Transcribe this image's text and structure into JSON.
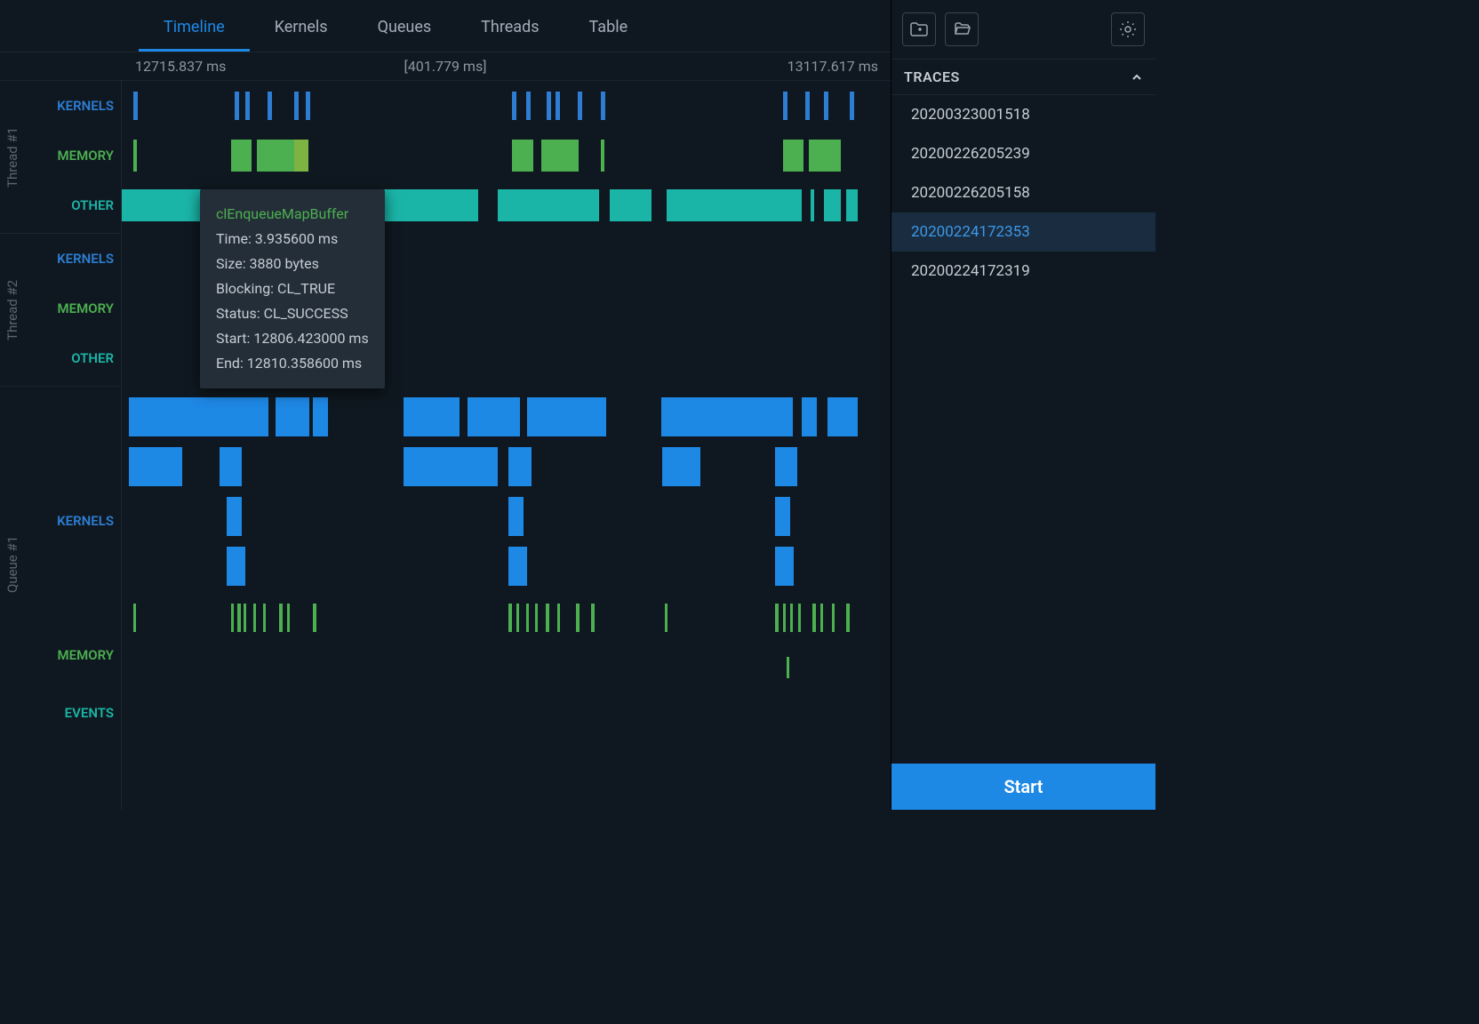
{
  "tabs": [
    "Timeline",
    "Kernels",
    "Queues",
    "Threads",
    "Table"
  ],
  "active_tab": 0,
  "timebar": {
    "start": "12715.837 ms",
    "span": "[401.779 ms]",
    "end": "13117.617 ms"
  },
  "groups": [
    {
      "name": "Thread #1",
      "rows": [
        {
          "label": "KERNELS",
          "color": "c-blue"
        },
        {
          "label": "MEMORY",
          "color": "c-green"
        },
        {
          "label": "OTHER",
          "color": "c-teal"
        }
      ]
    },
    {
      "name": "Thread #2",
      "rows": [
        {
          "label": "KERNELS",
          "color": "c-blue"
        },
        {
          "label": "MEMORY",
          "color": "c-green"
        },
        {
          "label": "OTHER",
          "color": "c-teal"
        }
      ]
    },
    {
      "name": "Queue #1",
      "rows": [
        {
          "label": "KERNELS",
          "color": "c-blue"
        },
        {
          "label": "MEMORY",
          "color": "c-green"
        },
        {
          "label": "EVENTS",
          "color": "c-teal"
        }
      ]
    }
  ],
  "tooltip": {
    "title": "clEnqueueMapBuffer",
    "time": "Time: 3.935600 ms",
    "size": "Size: 3880 bytes",
    "blocking": "Blocking: CL_TRUE",
    "status": "Status: CL_SUCCESS",
    "start": "Start: 12806.423000 ms",
    "end": "End: 12810.358600 ms"
  },
  "traces_header": "TRACES",
  "traces": [
    "20200323001518",
    "20200226205239",
    "20200226205158",
    "20200224172353",
    "20200224172319"
  ],
  "traces_selected": 3,
  "start_label": "Start",
  "chart_data": {
    "type": "bar",
    "x_range_ms": [
      12715.837,
      13117.617
    ],
    "span_ms": 401.779,
    "colors": {
      "KERNELS": "#2d7dd2",
      "MEMORY": "#4caf50",
      "OTHER": "#1bb5a8",
      "EVENTS": "#1bb5a8"
    },
    "lanes": {
      "thread1_kernels": [
        [
          1.5,
          0.6
        ],
        [
          15.0,
          0.6
        ],
        [
          16.5,
          0.6
        ],
        [
          19.4,
          0.6
        ],
        [
          22.9,
          0.6
        ],
        [
          24.5,
          0.6
        ],
        [
          52.0,
          0.6
        ],
        [
          53.8,
          0.6
        ],
        [
          56.6,
          0.6
        ],
        [
          57.7,
          0.6
        ],
        [
          60.7,
          0.6
        ],
        [
          63.8,
          0.6
        ],
        [
          88.0,
          0.6
        ],
        [
          91.0,
          0.6
        ],
        [
          93.5,
          0.6
        ],
        [
          96.9,
          0.6
        ]
      ],
      "thread1_memory": [
        [
          1.5,
          0.5
        ],
        [
          14.5,
          2.8
        ],
        [
          18.0,
          5.0
        ],
        [
          52.0,
          2.8
        ],
        [
          55.8,
          5.0
        ],
        [
          63.8,
          0.5
        ],
        [
          88.0,
          2.8
        ],
        [
          91.5,
          4.2
        ]
      ],
      "thread1_other": [
        [
          0,
          10.5
        ],
        [
          24.0,
          23.5
        ],
        [
          50.0,
          13.5
        ],
        [
          65.0,
          5.5
        ],
        [
          72.5,
          18.0
        ],
        [
          91.7,
          0.5
        ],
        [
          93.5,
          2.3
        ],
        [
          96.5,
          1.5
        ]
      ],
      "thread2_kernels": [],
      "thread2_memory": [],
      "thread2_other": [],
      "queue1_kernels_rows": [
        [
          [
            1,
            18.5
          ],
          [
            20.5,
            4.5
          ],
          [
            25.5,
            2.0
          ],
          [
            37.5,
            7.5
          ],
          [
            46,
            7.0
          ],
          [
            54,
            10.5
          ],
          [
            71.8,
            17.5
          ],
          [
            90.5,
            2.0
          ],
          [
            94,
            4.0
          ]
        ],
        [
          [
            1,
            7.0
          ],
          [
            13.0,
            3.0
          ],
          [
            37.5,
            12.5
          ],
          [
            51.5,
            3.0
          ],
          [
            72,
            5.0
          ],
          [
            87,
            3.0
          ]
        ],
        [
          [
            14,
            2.0
          ],
          [
            51.5,
            2.0
          ],
          [
            87,
            2.0
          ]
        ],
        [
          [
            14,
            2.5
          ],
          [
            51.5,
            2.5
          ],
          [
            87,
            2.5
          ]
        ]
      ],
      "queue1_memory": [
        [
          1.5,
          0.4
        ],
        [
          14.5,
          0.4
        ],
        [
          15.4,
          0.4
        ],
        [
          16.2,
          0.4
        ],
        [
          17.5,
          0.4
        ],
        [
          18.8,
          0.4
        ],
        [
          21,
          0.4
        ],
        [
          22,
          0.4
        ],
        [
          25.5,
          0.4
        ],
        [
          51.5,
          0.4
        ],
        [
          52.5,
          0.4
        ],
        [
          53.8,
          0.4
        ],
        [
          55,
          0.4
        ],
        [
          56.5,
          0.4
        ],
        [
          58,
          0.4
        ],
        [
          60.5,
          0.4
        ],
        [
          62.5,
          0.4
        ],
        [
          72.3,
          0.4
        ],
        [
          87,
          0.4
        ],
        [
          88,
          0.4
        ],
        [
          89,
          0.4
        ],
        [
          90,
          0.4
        ],
        [
          92,
          0.4
        ],
        [
          93,
          0.4
        ],
        [
          94.5,
          0.4
        ],
        [
          96.5,
          0.4
        ]
      ],
      "queue1_events": [
        [
          88.5,
          0.4
        ]
      ]
    }
  }
}
